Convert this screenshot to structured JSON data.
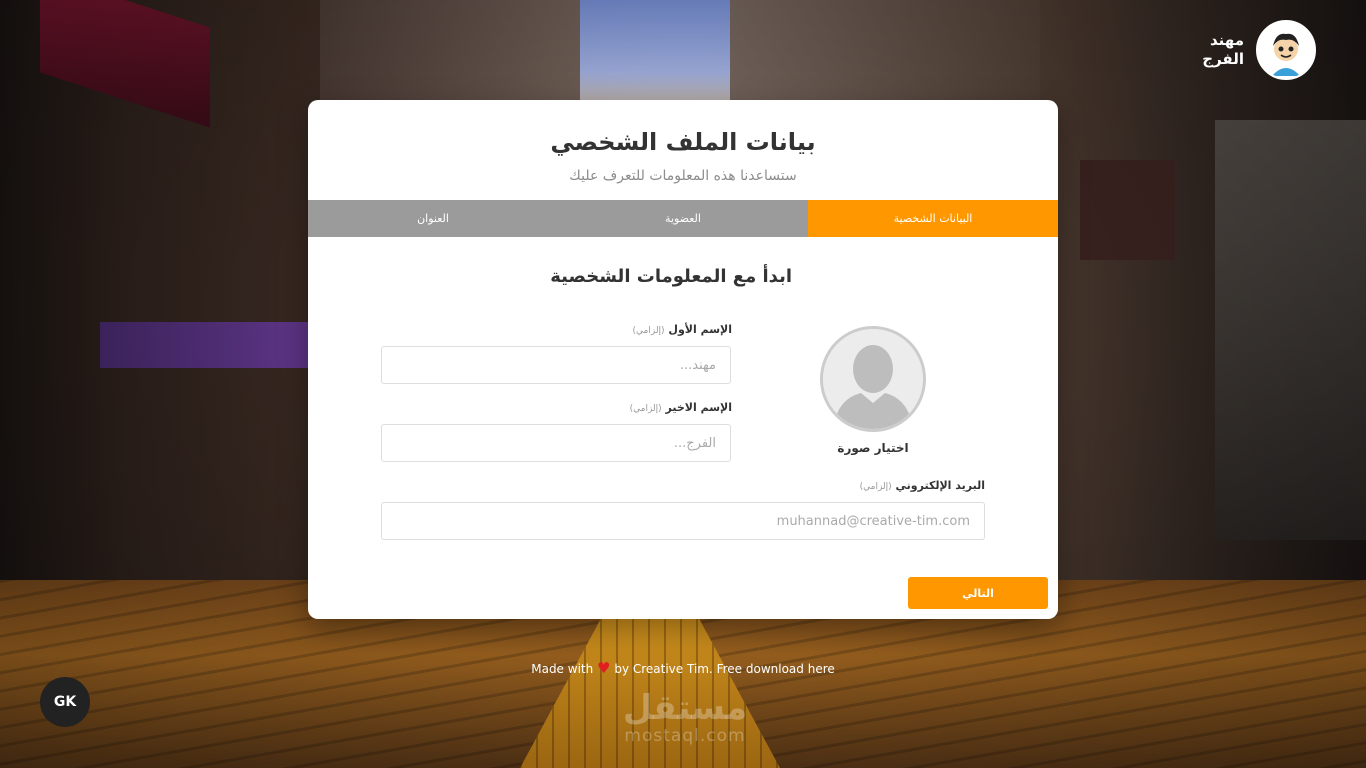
{
  "user": {
    "name": "مهند الفرج"
  },
  "card": {
    "title": "بيانات الملف الشخصي",
    "subtitle": "ستساعدنا هذه المعلومات للتعرف عليك",
    "tabs": [
      {
        "label": "البيانات الشخصية",
        "active": true
      },
      {
        "label": "العضوية",
        "active": false
      },
      {
        "label": "العنوان",
        "active": false
      }
    ],
    "section_title": "ابدأ مع المعلومات الشخصية",
    "picture_label": "اختيار صورة",
    "first_name": {
      "label": "الإسم الأول",
      "required": "(إلزامي)",
      "placeholder": "مهند..."
    },
    "last_name": {
      "label": "الإسم الاخير",
      "required": "(إلزامي)",
      "placeholder": "الفرج..."
    },
    "email": {
      "label": "البريد الإلكتروني",
      "required": "(إلزامي)",
      "placeholder": "muhannad@creative-tim.com"
    },
    "next_button": "التالي"
  },
  "footer": {
    "made_with": "Made with",
    "by_text": "by Creative Tim. Free download here"
  },
  "watermark": {
    "arabic": "مستقل",
    "latin": "mostaql.com"
  },
  "corner_badge": "GK",
  "colors": {
    "accent": "#ff9800",
    "tab_bar": "#9b9b9b",
    "heart": "#e02020"
  }
}
